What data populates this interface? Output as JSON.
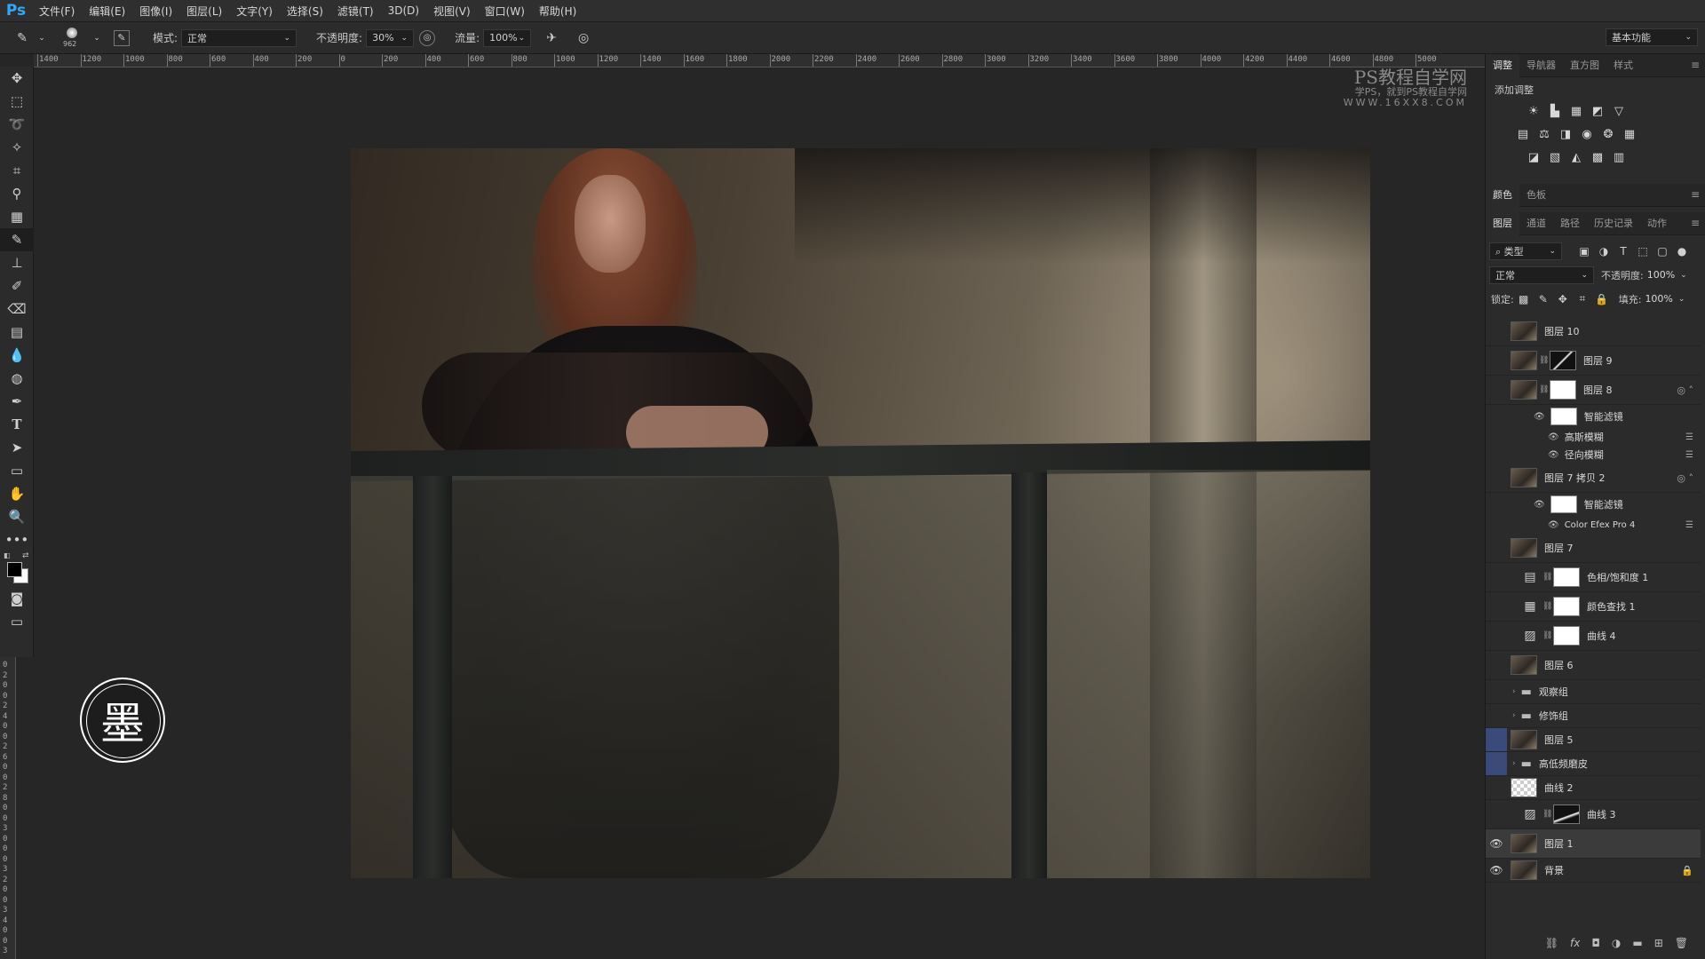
{
  "app": {
    "logo": "Ps",
    "accent": "#31a8ff"
  },
  "menu": [
    "文件(F)",
    "编辑(E)",
    "图像(I)",
    "图层(L)",
    "文字(Y)",
    "选择(S)",
    "滤镜(T)",
    "3D(D)",
    "视图(V)",
    "窗口(W)",
    "帮助(H)"
  ],
  "options": {
    "brush_size": "962",
    "mode_label": "模式:",
    "mode_value": "正常",
    "opacity_label": "不透明度:",
    "opacity_value": "30%",
    "flow_label": "流量:",
    "flow_value": "100%",
    "workspace": "基本功能"
  },
  "ruler_top": [
    "1400",
    "1200",
    "1000",
    "800",
    "600",
    "400",
    "200",
    "0",
    "200",
    "400",
    "600",
    "800",
    "1000",
    "1200",
    "1400",
    "1600",
    "1800",
    "2000",
    "2200",
    "2400",
    "2600",
    "2800",
    "3000",
    "3200",
    "3400",
    "3600",
    "3800",
    "4000",
    "4200",
    "4400",
    "4600",
    "4800",
    "5000"
  ],
  "ruler_left": [
    "0",
    "2",
    "0",
    "0",
    "2",
    "4",
    "0",
    "0",
    "2",
    "6",
    "0",
    "0",
    "2",
    "8",
    "0",
    "0",
    "3",
    "0",
    "0",
    "0",
    "3",
    "2",
    "0",
    "0",
    "3",
    "4",
    "0",
    "0",
    "3"
  ],
  "watermark": {
    "title": "PS教程自学网",
    "sub": "学PS，就到PS教程自学网",
    "url": "WWW.16XX8.COM"
  },
  "logo_char": "墨",
  "panels": {
    "top_tabs": [
      "调整",
      "导航器",
      "直方图",
      "样式"
    ],
    "adjust_title": "添加调整",
    "color_tabs": [
      "颜色",
      "色板"
    ],
    "layer_tabs": [
      "图层",
      "通道",
      "路径",
      "历史记录",
      "动作"
    ],
    "filter_kind": "类型",
    "blend_mode": "正常",
    "opacity_label": "不透明度:",
    "opacity_value": "100%",
    "lock_label": "锁定:",
    "fill_label": "填充:",
    "fill_value": "100%"
  },
  "layers": [
    {
      "name": "图层 10"
    },
    {
      "name": "图层 9"
    },
    {
      "name": "图层 8"
    },
    {
      "name": "智能滤镜"
    },
    {
      "name": "高斯模糊"
    },
    {
      "name": "径向模糊"
    },
    {
      "name": "图层 7 拷贝 2"
    },
    {
      "name": "智能滤镜"
    },
    {
      "name": "Color Efex Pro 4"
    },
    {
      "name": "图层 7"
    },
    {
      "name": "色相/饱和度 1"
    },
    {
      "name": "颜色查找 1"
    },
    {
      "name": "曲线 4"
    },
    {
      "name": "图层 6"
    },
    {
      "name": "观察组"
    },
    {
      "name": "修饰组"
    },
    {
      "name": "图层 5"
    },
    {
      "name": "高低频磨皮"
    },
    {
      "name": "曲线 2"
    },
    {
      "name": "曲线 3"
    },
    {
      "name": "图层 1"
    },
    {
      "name": "背景"
    }
  ]
}
